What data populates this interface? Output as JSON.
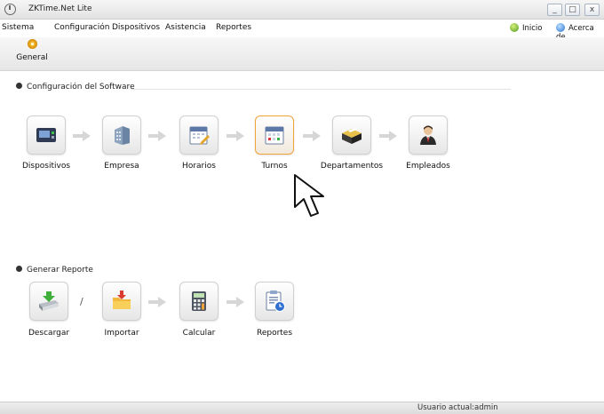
{
  "window": {
    "title": "ZKTime.Net Lite",
    "minimize": "_",
    "maximize": "□",
    "close": "x"
  },
  "menu": {
    "items": [
      "Sistema",
      "Configuración",
      "Dispositivos",
      "Asistencia",
      "Reportes"
    ],
    "right": [
      "Inicio",
      "Acerca de"
    ]
  },
  "toolbar": {
    "general_label": "General"
  },
  "config_section": {
    "title": "Configuración del Software",
    "items": [
      "Dispositivos",
      "Empresa",
      "Horarios",
      "Turnos",
      "Departamentos",
      "Empleados"
    ],
    "active": "Turnos"
  },
  "report_section": {
    "title": "Generar Reporte",
    "separator": "/",
    "items": [
      "Descargar",
      "Importar",
      "Calcular",
      "Reportes"
    ]
  },
  "status": {
    "text": "Usuario actual:admin"
  },
  "colors": {
    "active_tile_border": "#f0a43a",
    "toolbar_bg": "#e6e6e6",
    "arrow": "#d6d6d6"
  }
}
